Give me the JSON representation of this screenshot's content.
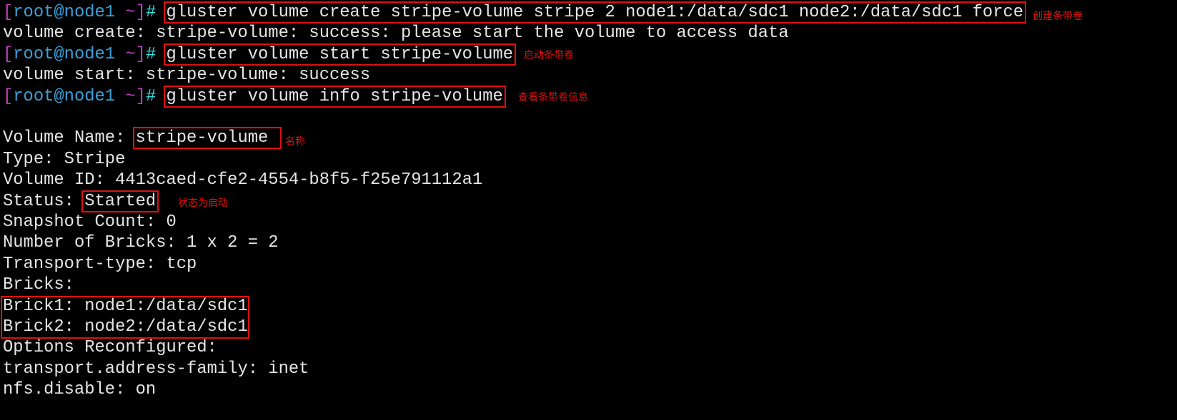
{
  "prompt": {
    "open": "[",
    "user": "root@node1 ",
    "tilde": "~",
    "close": "]",
    "hash": "#"
  },
  "commands": [
    "gluster volume create stripe-volume stripe 2 node1:/data/sdc1 node2:/data/sdc1 force",
    "gluster volume start stripe-volume",
    "gluster volume info stripe-volume"
  ],
  "outputs": {
    "create": "volume create: stripe-volume: success: please start the volume to access data",
    "start": "volume start: stripe-volume: success",
    "info": {
      "name_label": "Volume Name: ",
      "name_value": "stripe-volume ",
      "type": "Type: Stripe",
      "id": "Volume ID: 4413caed-cfe2-4554-b8f5-f25e791112a1",
      "status_label": "Status: ",
      "status_value": "Started",
      "snapshot": "Snapshot Count: 0",
      "bricks_count": "Number of Bricks: 1 x 2 = 2",
      "transport": "Transport-type: tcp",
      "bricks_header": "Bricks:",
      "brick1": "Brick1: node1:/data/sdc1",
      "brick2": "Brick2: node2:/data/sdc1",
      "options_header": "Options Reconfigured:",
      "opt1": "transport.address-family: inet",
      "opt2": "nfs.disable: on"
    }
  },
  "annotations": {
    "create": "创建条带卷",
    "start": "启动条带卷",
    "info": "查看条带卷信息",
    "name": "名称",
    "status": "状态为启动"
  },
  "colors": {
    "highlight_box": "#e01010",
    "prompt_bracket": "#c040c0",
    "prompt_user": "#3aa0d8",
    "prompt_hash": "#30e0e0",
    "text": "#e6e6e6",
    "background": "#000000"
  }
}
